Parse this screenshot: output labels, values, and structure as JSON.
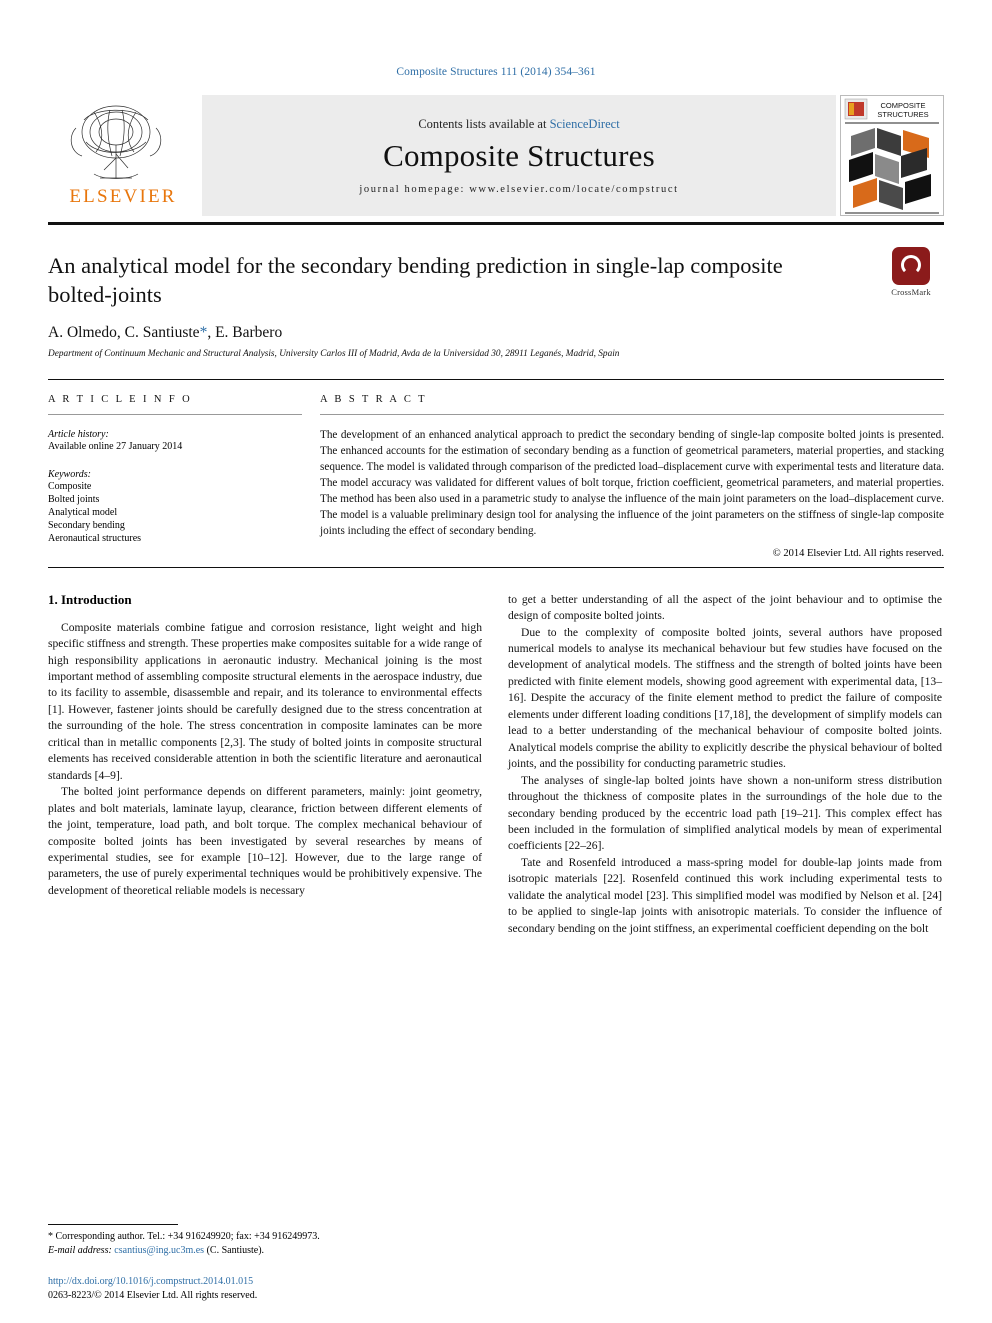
{
  "journal_ref": "Composite Structures 111 (2014) 354–361",
  "masthead": {
    "contents_prefix": "Contents lists available at ",
    "sciencedirect": "ScienceDirect",
    "journal_title": "Composite Structures",
    "homepage": "journal homepage: www.elsevier.com/locate/compstruct",
    "publisher": "ELSEVIER",
    "cover_line1": "COMPOSITE",
    "cover_line2": "STRUCTURES"
  },
  "article": {
    "title": "An analytical model for the secondary bending prediction in single-lap composite bolted-joints",
    "authors_pre": "A. Olmedo, C. Santiuste",
    "authors_star": "*",
    "authors_post": ", E. Barbero",
    "affiliation": "Department of Continuum Mechanic and Structural Analysis, University Carlos III of Madrid, Avda de la Universidad 30, 28911 Leganés, Madrid, Spain",
    "crossmark_label": "CrossMark"
  },
  "info": {
    "heading": "A R T I C L E    I N F O",
    "history_label": "Article history:",
    "history_line": "Available online 27 January 2014",
    "keywords_label": "Keywords:",
    "keywords": [
      "Composite",
      "Bolted joints",
      "Analytical model",
      "Secondary bending",
      "Aeronautical structures"
    ]
  },
  "abstract": {
    "heading": "A B S T R A C T",
    "text": "The development of an enhanced analytical approach to predict the secondary bending of single-lap composite bolted joints is presented. The enhanced accounts for the estimation of secondary bending as a function of geometrical parameters, material properties, and stacking sequence. The model is validated through comparison of the predicted load–displacement curve with experimental tests and literature data. The model accuracy was validated for different values of bolt torque, friction coefficient, geometrical parameters, and material properties. The method has been also used in a parametric study to analyse the influence of the main joint parameters on the load–displacement curve. The model is a valuable preliminary design tool for analysing the influence of the joint parameters on the stiffness of single-lap composite joints including the effect of secondary bending.",
    "copyright": "© 2014 Elsevier Ltd. All rights reserved."
  },
  "body": {
    "section_title": "1. Introduction",
    "left_paragraphs": [
      "Composite materials combine fatigue and corrosion resistance, light weight and high specific stiffness and strength. These properties make composites suitable for a wide range of high responsibility applications in aeronautic industry. Mechanical joining is the most important method of assembling composite structural elements in the aerospace industry, due to its facility to assemble, disassemble and repair, and its tolerance to environmental effects [1]. However, fastener joints should be carefully designed due to the stress concentration at the surrounding of the hole. The stress concentration in composite laminates can be more critical than in metallic components [2,3]. The study of bolted joints in composite structural elements has received considerable attention in both the scientific literature and aeronautical standards [4–9].",
      "The bolted joint performance depends on different parameters, mainly: joint geometry, plates and bolt materials, laminate layup, clearance, friction between different elements of the joint, temperature, load path, and bolt torque. The complex mechanical behaviour of composite bolted joints has been investigated by several researches by means of experimental studies, see for example [10–12]. However, due to the large range of parameters, the use of purely experimental techniques would be prohibitively expensive. The development of theoretical reliable models is necessary"
    ],
    "right_paragraphs": [
      "to get a better understanding of all the aspect of the joint behaviour and to optimise the design of composite bolted joints.",
      "Due to the complexity of composite bolted joints, several authors have proposed numerical models to analyse its mechanical behaviour but few studies have focused on the development of analytical models. The stiffness and the strength of bolted joints have been predicted with finite element models, showing good agreement with experimental data, [13–16]. Despite the accuracy of the finite element method to predict the failure of composite elements under different loading conditions [17,18], the development of simplify models can lead to a better understanding of the mechanical behaviour of composite bolted joints. Analytical models comprise the ability to explicitly describe the physical behaviour of bolted joints, and the possibility for conducting parametric studies.",
      "The analyses of single-lap bolted joints have shown a non-uniform stress distribution throughout the thickness of composite plates in the surroundings of the hole due to the secondary bending produced by the eccentric load path [19–21]. This complex effect has been included in the formulation of simplified analytical models by mean of experimental coefficients [22–26].",
      "Tate and Rosenfeld introduced a mass-spring model for double-lap joints made from isotropic materials [22]. Rosenfeld continued this work including experimental tests to validate the analytical model [23]. This simplified model was modified by Nelson et al. [24] to be applied to single-lap joints with anisotropic materials. To consider the influence of secondary bending on the joint stiffness, an experimental coefficient depending on the bolt"
    ]
  },
  "footnote": {
    "corresponding": "* Corresponding author. Tel.: +34 916249920; fax: +34 916249973.",
    "email_label": "E-mail address:",
    "email": "csantius@ing.uc3m.es",
    "email_suffix": " (C. Santiuste)."
  },
  "footer": {
    "doi": "http://dx.doi.org/10.1016/j.compstruct.2014.01.015",
    "issn": "0263-8223/© 2014 Elsevier Ltd. All rights reserved."
  }
}
